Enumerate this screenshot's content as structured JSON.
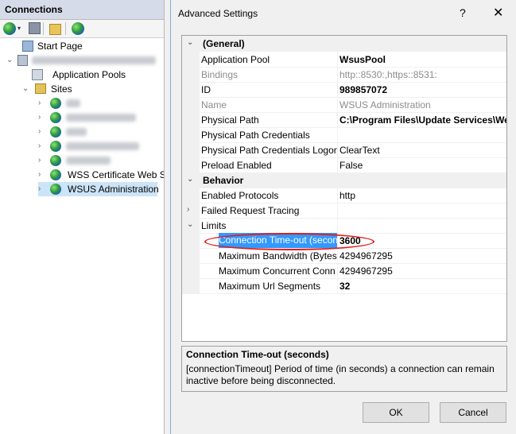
{
  "connections": {
    "header": "Connections",
    "tree": {
      "start_page": "Start Page",
      "server": "",
      "application_pools": "Application Pools",
      "sites": "Sites",
      "site_items": [
        "",
        "",
        "",
        "",
        "",
        "WSS Certificate Web S",
        "WSUS Administration"
      ]
    }
  },
  "dialog": {
    "title": "Advanced Settings",
    "help": "?",
    "close": "✕",
    "categories": {
      "general": "(General)",
      "behavior": "Behavior",
      "limits": "Limits"
    },
    "general": [
      {
        "name": "Application Pool",
        "value": "WsusPool"
      },
      {
        "name": "Bindings",
        "value": "http::8530:,https::8531:"
      },
      {
        "name": "ID",
        "value": "989857072"
      },
      {
        "name": "Name",
        "value": "WSUS Administration"
      },
      {
        "name": "Physical Path",
        "value": "C:\\Program Files\\Update Services\\We"
      },
      {
        "name": "Physical Path Credentials",
        "value": ""
      },
      {
        "name": "Physical Path Credentials Logon",
        "value": "ClearText"
      },
      {
        "name": "Preload Enabled",
        "value": "False"
      }
    ],
    "behavior": [
      {
        "name": "Enabled Protocols",
        "value": "http"
      },
      {
        "name": "Failed Request Tracing",
        "value": ""
      }
    ],
    "limits": [
      {
        "name": "Connection Time-out (secon",
        "value": "3600"
      },
      {
        "name": "Maximum Bandwidth (Bytes",
        "value": "4294967295"
      },
      {
        "name": "Maximum Concurrent Conn",
        "value": "4294967295"
      },
      {
        "name": "Maximum Url Segments",
        "value": "32"
      }
    ],
    "description": {
      "title": "Connection Time-out (seconds)",
      "text": "[connectionTimeout] Period of time (in seconds) a connection can remain inactive before being disconnected."
    },
    "ok_label": "OK",
    "cancel_label": "Cancel"
  }
}
